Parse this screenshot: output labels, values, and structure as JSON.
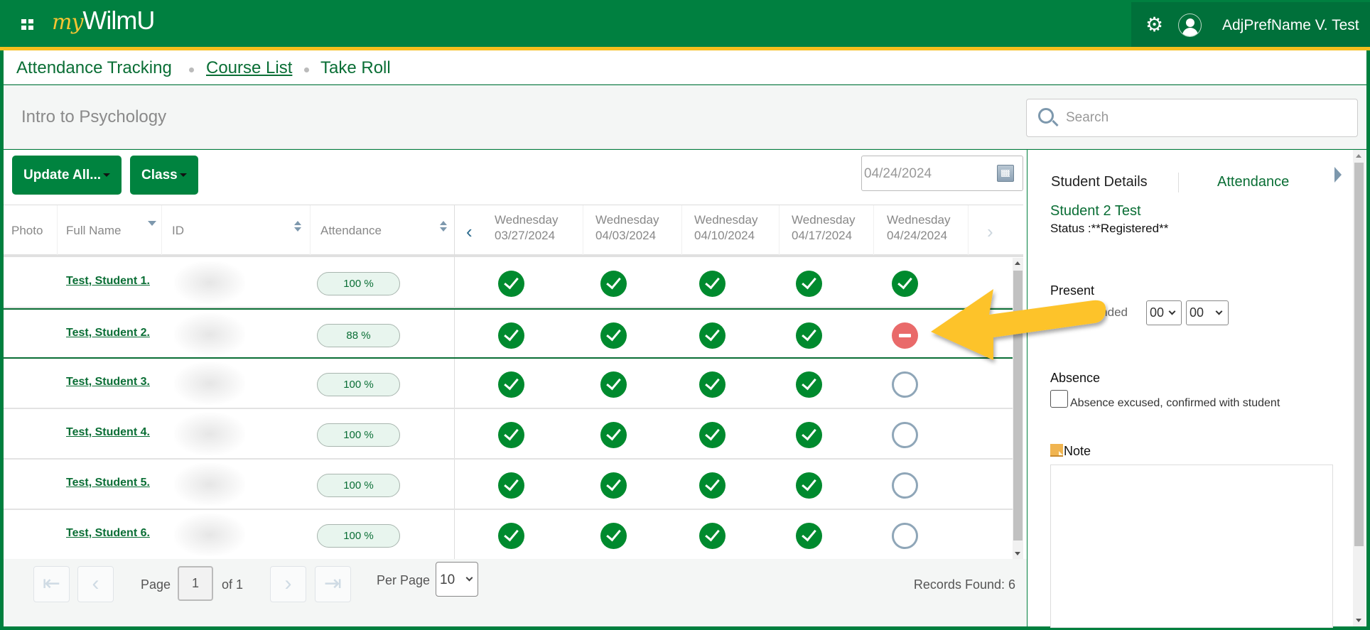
{
  "header": {
    "logo_prefix": "my",
    "logo_main": "WilmU",
    "user_name": "AdjPrefName V. Test",
    "icons": [
      "apps-grid-icon",
      "gear-icon",
      "user-avatar-icon"
    ],
    "colors": {
      "brand_green": "#008040",
      "gold": "#f6be1e",
      "link_green": "#0a6e35"
    }
  },
  "breadcrumb": {
    "items": [
      {
        "label": "Attendance Tracking",
        "link": false
      },
      {
        "label": "Course List",
        "link": true
      },
      {
        "label": "Take Roll",
        "link": false
      }
    ]
  },
  "course": {
    "title": "Intro to Psychology",
    "search_placeholder": "Search"
  },
  "toolbar": {
    "update_all_label": "Update All...",
    "class_label": "Class",
    "date_value": "04/24/2024"
  },
  "table": {
    "columns": {
      "photo": "Photo",
      "full_name": "Full Name",
      "id": "ID",
      "attendance": "Attendance"
    },
    "dates": [
      {
        "day": "Wednesday",
        "date": "03/27/2024"
      },
      {
        "day": "Wednesday",
        "date": "04/03/2024"
      },
      {
        "day": "Wednesday",
        "date": "04/10/2024"
      },
      {
        "day": "Wednesday",
        "date": "04/17/2024"
      },
      {
        "day": "Wednesday",
        "date": "04/24/2024"
      }
    ],
    "rows": [
      {
        "name": "Test, Student 1.",
        "attendance": "100 %",
        "marks": [
          "present",
          "present",
          "present",
          "present",
          "present"
        ],
        "selected": false
      },
      {
        "name": "Test, Student 2.",
        "attendance": "88 %",
        "marks": [
          "present",
          "present",
          "present",
          "present",
          "absent"
        ],
        "selected": true
      },
      {
        "name": "Test, Student 3.",
        "attendance": "100 %",
        "marks": [
          "present",
          "present",
          "present",
          "present",
          "none"
        ],
        "selected": false
      },
      {
        "name": "Test, Student 4.",
        "attendance": "100 %",
        "marks": [
          "present",
          "present",
          "present",
          "present",
          "none"
        ],
        "selected": false
      },
      {
        "name": "Test, Student 5.",
        "attendance": "100 %",
        "marks": [
          "present",
          "present",
          "present",
          "present",
          "none"
        ],
        "selected": false
      },
      {
        "name": "Test, Student 6.",
        "attendance": "100 %",
        "marks": [
          "present",
          "present",
          "present",
          "present",
          "none"
        ],
        "selected": false
      }
    ]
  },
  "pager": {
    "page_label": "Page",
    "page_value": "1",
    "of_label": "of 1",
    "per_page_label": "Per Page",
    "per_page_value": "10",
    "records_found": "Records Found: 6"
  },
  "details": {
    "tab_student_details": "Student Details",
    "tab_attendance": "Attendance",
    "student_name": "Student 2 Test",
    "status": "Status :**Registered**",
    "present_label": "Present",
    "time_attended_label": "Time Attended",
    "hours_value": "00",
    "minutes_value": "00",
    "absence_label": "Absence",
    "excused_label": "Absence excused, confirmed with student",
    "note_label": "Note"
  }
}
